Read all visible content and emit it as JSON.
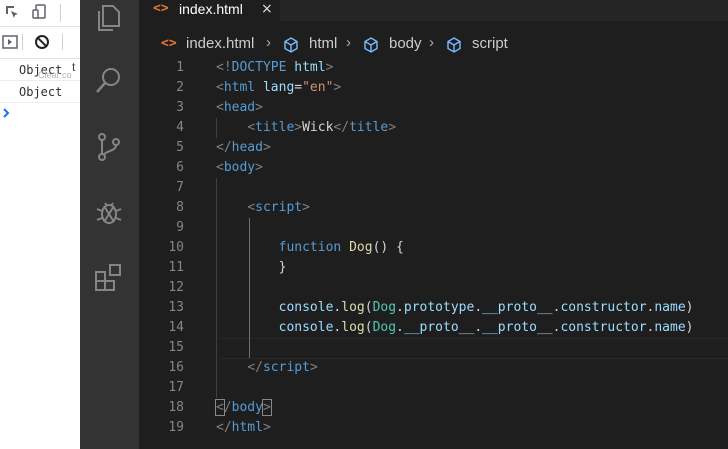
{
  "console": {
    "rows": [
      "Object",
      "Object"
    ],
    "filter_placeholder": "Clear co",
    "truncated_label": "t"
  },
  "activity_bar": {
    "icons": [
      "explorer-icon",
      "search-icon",
      "source-control-icon",
      "run-debug-icon",
      "extensions-icon"
    ]
  },
  "tab": {
    "icon": "<>",
    "label": "index.html",
    "close": "×"
  },
  "breadcrumb": {
    "file": "index.html",
    "items": [
      "html",
      "body",
      "script"
    ]
  },
  "code": {
    "line_numbers": [
      "1",
      "2",
      "3",
      "4",
      "5",
      "6",
      "7",
      "8",
      "9",
      "10",
      "11",
      "12",
      "13",
      "14",
      "15",
      "16",
      "17",
      "18",
      "19"
    ],
    "lines": [
      [
        [
          "t-br",
          "<!"
        ],
        [
          "t-tag",
          "DOCTYPE"
        ],
        [
          "t-txt",
          " "
        ],
        [
          "t-att",
          "html"
        ],
        [
          "t-br",
          ">"
        ]
      ],
      [
        [
          "t-br",
          "<"
        ],
        [
          "t-tag",
          "html"
        ],
        [
          "t-txt",
          " "
        ],
        [
          "t-att",
          "lang"
        ],
        [
          "t-txt",
          "="
        ],
        [
          "t-str",
          "\"en\""
        ],
        [
          "t-br",
          ">"
        ]
      ],
      [
        [
          "t-br",
          "<"
        ],
        [
          "t-tag",
          "head"
        ],
        [
          "t-br",
          ">"
        ]
      ],
      [
        [
          "t-txt",
          "    "
        ],
        [
          "t-br",
          "<"
        ],
        [
          "t-tag",
          "title"
        ],
        [
          "t-br",
          ">"
        ],
        [
          "t-txt",
          "Wick"
        ],
        [
          "t-br",
          "</"
        ],
        [
          "t-tag",
          "title"
        ],
        [
          "t-br",
          ">"
        ]
      ],
      [
        [
          "t-br",
          "</"
        ],
        [
          "t-tag",
          "head"
        ],
        [
          "t-br",
          ">"
        ]
      ],
      [
        [
          "t-br",
          "<"
        ],
        [
          "t-tag",
          "body"
        ],
        [
          "t-br",
          ">"
        ]
      ],
      [],
      [
        [
          "t-txt",
          "    "
        ],
        [
          "t-br",
          "<"
        ],
        [
          "t-tag",
          "script"
        ],
        [
          "t-br",
          ">"
        ]
      ],
      [],
      [
        [
          "t-txt",
          "        "
        ],
        [
          "t-kw",
          "function"
        ],
        [
          "t-txt",
          " "
        ],
        [
          "t-fn",
          "Dog"
        ],
        [
          "t-pun",
          "() {"
        ]
      ],
      [
        [
          "t-txt",
          "        "
        ],
        [
          "t-pun",
          "}"
        ]
      ],
      [],
      [
        [
          "t-txt",
          "        "
        ],
        [
          "t-prop",
          "console"
        ],
        [
          "t-pun",
          "."
        ],
        [
          "t-fn",
          "log"
        ],
        [
          "t-pun",
          "("
        ],
        [
          "t-cls",
          "Dog"
        ],
        [
          "t-pun",
          "."
        ],
        [
          "t-prop",
          "prototype"
        ],
        [
          "t-pun",
          "."
        ],
        [
          "t-prop",
          "__proto__"
        ],
        [
          "t-pun",
          "."
        ],
        [
          "t-prop",
          "constructor"
        ],
        [
          "t-pun",
          "."
        ],
        [
          "t-prop",
          "name"
        ],
        [
          "t-pun",
          ")"
        ]
      ],
      [
        [
          "t-txt",
          "        "
        ],
        [
          "t-prop",
          "console"
        ],
        [
          "t-pun",
          "."
        ],
        [
          "t-fn",
          "log"
        ],
        [
          "t-pun",
          "("
        ],
        [
          "t-cls",
          "Dog"
        ],
        [
          "t-pun",
          "."
        ],
        [
          "t-prop",
          "__proto__"
        ],
        [
          "t-pun",
          "."
        ],
        [
          "t-prop",
          "__proto__"
        ],
        [
          "t-pun",
          "."
        ],
        [
          "t-prop",
          "constructor"
        ],
        [
          "t-pun",
          "."
        ],
        [
          "t-prop",
          "name"
        ],
        [
          "t-pun",
          ")"
        ]
      ],
      [],
      [
        [
          "t-txt",
          "    "
        ],
        [
          "t-br",
          "</"
        ],
        [
          "t-tag",
          "script"
        ],
        [
          "t-br",
          ">"
        ]
      ],
      [],
      [
        [
          "t-br t-match",
          "<"
        ],
        [
          "t-br",
          "/"
        ],
        [
          "t-tag",
          "body"
        ],
        [
          "t-br t-match",
          ">"
        ]
      ],
      [
        [
          "t-br",
          "</"
        ],
        [
          "t-tag",
          "html"
        ],
        [
          "t-br",
          ">"
        ]
      ]
    ]
  },
  "colors": {
    "editor_bg": "#1e1e1e",
    "activity_bg": "#333333",
    "tab_icon": "#e37933",
    "breadcrumb_icon": "#75beff"
  }
}
